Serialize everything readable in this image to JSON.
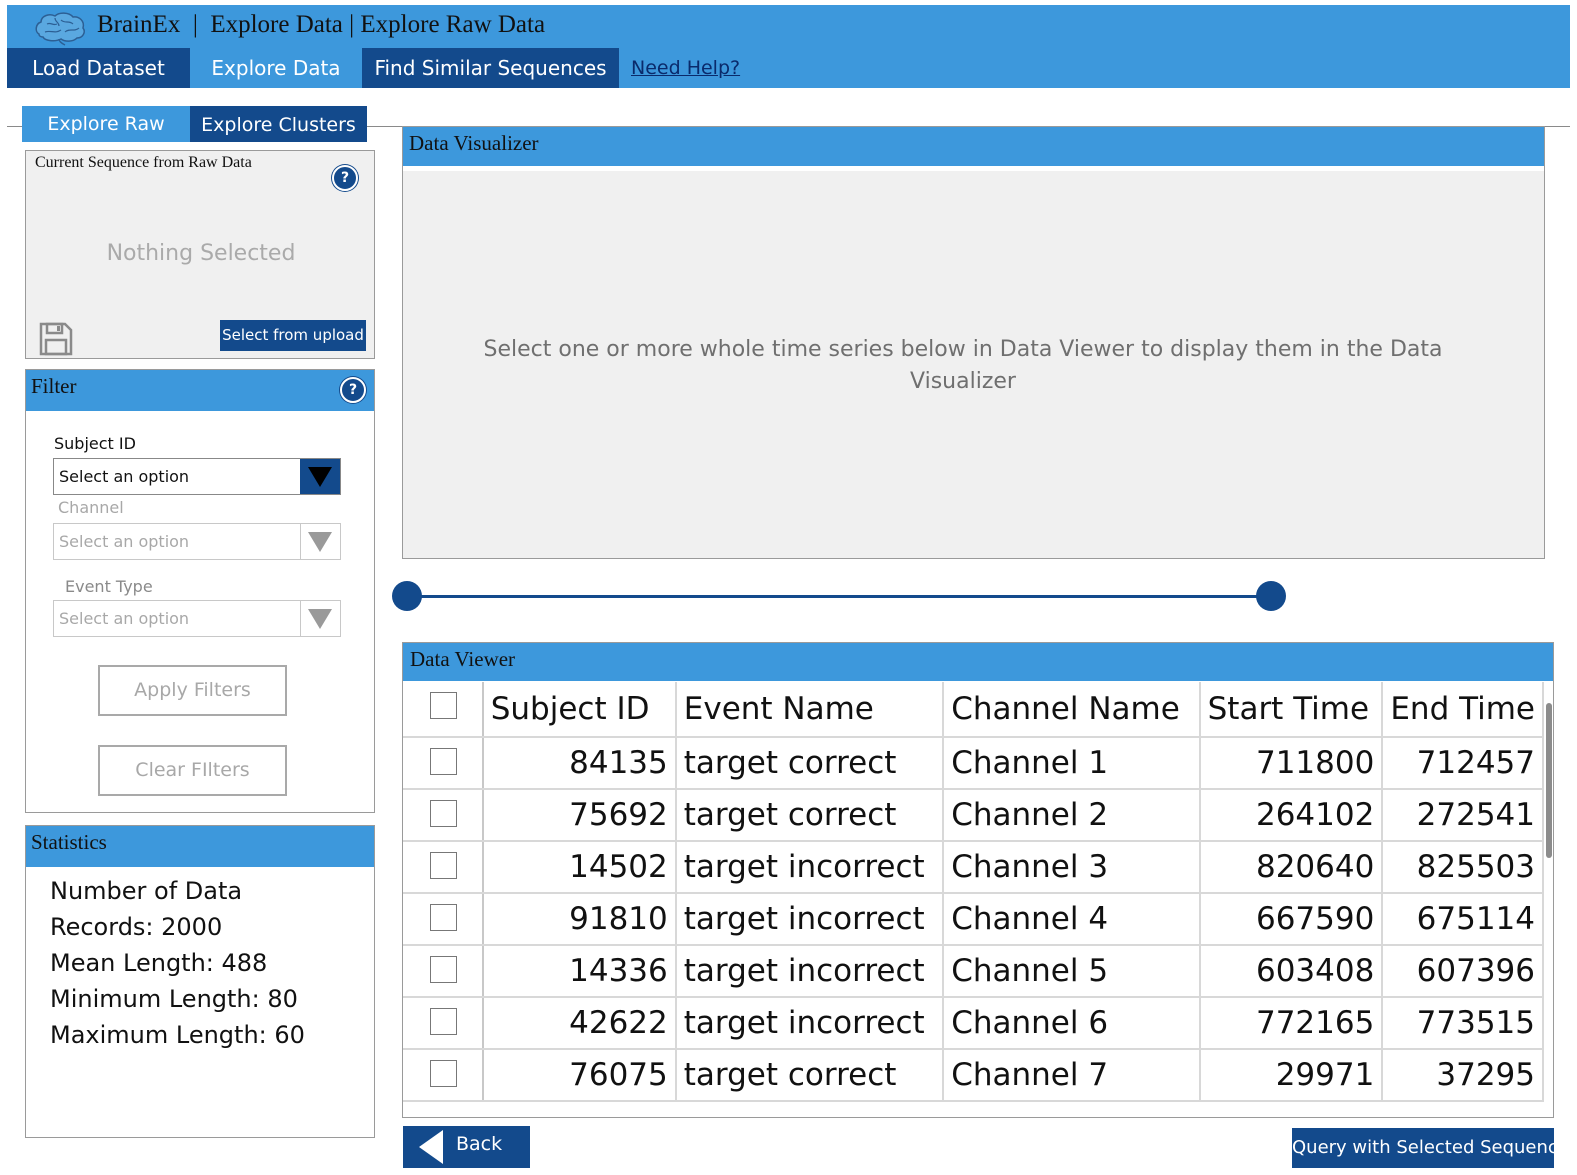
{
  "header": {
    "app_name": "BrainEx",
    "separator": "|",
    "breadcrumb": "Explore Data | Explore Raw Data",
    "title_full": "BrainEx  |  Explore Data | Explore Raw Data"
  },
  "nav": {
    "load": "Load Dataset",
    "explore": "Explore Data",
    "find": "Find Similar Sequences",
    "help": "Need Help?"
  },
  "tabs": {
    "raw": "Explore Raw Data",
    "clusters": "Explore Clusters"
  },
  "sequence_panel": {
    "title": "Current Sequence from Raw Data",
    "help": "?",
    "empty": "Nothing Selected",
    "select_button": "Select from upload"
  },
  "filter": {
    "title": "Filter",
    "help": "?",
    "subject_label": "Subject ID",
    "subject_value": "Select an option",
    "channel_label": "Channel",
    "channel_value": "Select an option",
    "event_label": "Event Type",
    "event_value": "Select an option",
    "apply": "Apply Filters",
    "clear": "Clear FIlters"
  },
  "statistics": {
    "title": "Statistics",
    "lines": [
      "Number of Data",
      "Records: 2000",
      "Mean Length: 488",
      "Minimum Length: 80",
      "Maximum Length: 60"
    ]
  },
  "visualizer": {
    "title": "Data Visualizer",
    "message": "Select one or more whole time series below in Data Viewer to display them in the Data Visualizer"
  },
  "viewer": {
    "title": "Data Viewer",
    "columns": [
      "Subject ID",
      "Event Name",
      "Channel Name",
      "Start Time",
      "End Time"
    ],
    "rows": [
      [
        "84135",
        "target correct",
        "Channel 1",
        "711800",
        "712457"
      ],
      [
        "75692",
        "target correct",
        "Channel 2",
        "264102",
        "272541"
      ],
      [
        "14502",
        "target incorrect",
        "Channel 3",
        "820640",
        "825503"
      ],
      [
        "91810",
        "target incorrect",
        "Channel 4",
        "667590",
        "675114"
      ],
      [
        "14336",
        "target incorrect",
        "Channel 5",
        "603408",
        "607396"
      ],
      [
        "42622",
        "target incorrect",
        "Channel 6",
        "772165",
        "773515"
      ],
      [
        "76075",
        "target correct",
        "Channel 7",
        "29971",
        "37295"
      ]
    ]
  },
  "footer": {
    "back": "Back",
    "query": "Query with Selected Sequence"
  },
  "colors": {
    "accent": "#3d98dc",
    "dark": "#134a8c"
  }
}
